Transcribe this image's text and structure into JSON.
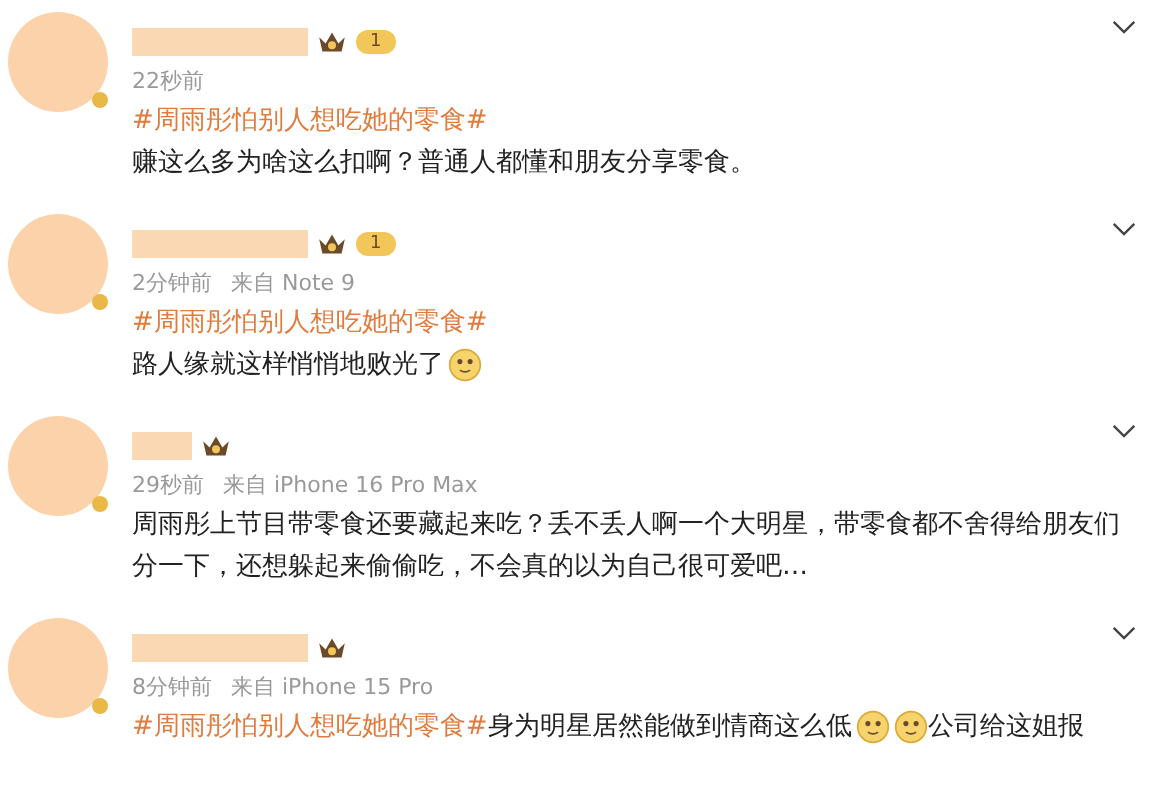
{
  "comments": [
    {
      "badge_text": "1",
      "time": "22秒前",
      "lines": [
        [
          {
            "kind": "hashtag",
            "text": "#周雨彤怕别人想吃她的零食#"
          }
        ],
        [
          {
            "kind": "text",
            "text": "赚这么多为啥这么扣啊？普通人都懂和朋友分享零食。"
          }
        ]
      ]
    },
    {
      "badge_text": "1",
      "time": "2分钟前",
      "source": "来自 Note 9",
      "lines": [
        [
          {
            "kind": "hashtag",
            "text": "#周雨彤怕别人想吃她的零食#"
          }
        ],
        [
          {
            "kind": "text",
            "text": "路人缘就这样悄悄地败光了"
          },
          {
            "kind": "emoji"
          }
        ]
      ]
    },
    {
      "time": "29秒前",
      "source": "来自 iPhone 16 Pro Max",
      "lines": [
        [
          {
            "kind": "text",
            "text": "周雨彤上节目带零食还要藏起来吃？丢不丢人啊一个大明星，带零食都不舍得给朋友们分一下，还想躲起来偷偷吃，不会真的以为自己很可爱吧…"
          }
        ]
      ]
    },
    {
      "time": "8分钟前",
      "source": "来自 iPhone 15 Pro",
      "lines": [
        [
          {
            "kind": "hashtag",
            "text": "#周雨彤怕别人想吃她的零食#"
          },
          {
            "kind": "text",
            "text": "身为明星居然能做到情商这么低"
          },
          {
            "kind": "emoji"
          },
          {
            "kind": "emoji"
          },
          {
            "kind": "text",
            "text": "公司给这姐报"
          }
        ]
      ]
    }
  ]
}
